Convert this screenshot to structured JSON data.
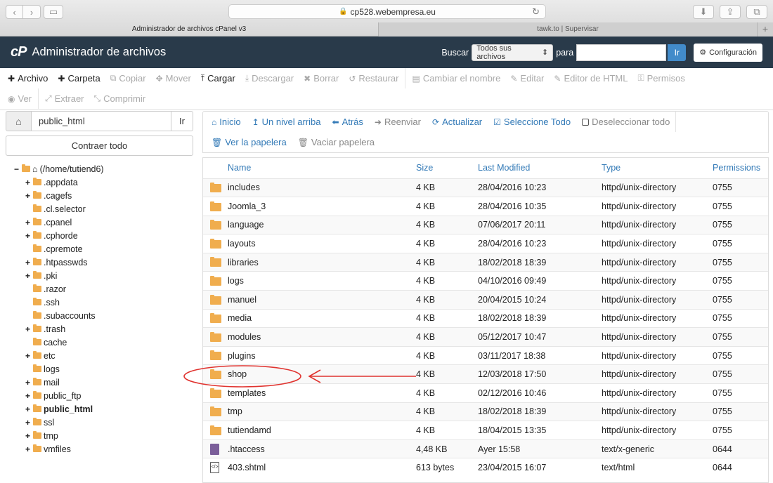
{
  "browser": {
    "url": "cp528.webempresa.eu",
    "tabs": [
      {
        "label": "Administrador de archivos cPanel v3",
        "active": true
      },
      {
        "label": "tawk.to | Supervisar",
        "active": false
      }
    ]
  },
  "header": {
    "logo": "cP",
    "title": "Administrador de archivos",
    "search_label": "Buscar",
    "search_scope": "Todos sus archivos",
    "for_label": "para",
    "search_query": "",
    "go_label": "Ir",
    "settings_label": "Configuración"
  },
  "toolbar": {
    "row1": [
      {
        "label": "Archivo",
        "icon": "plus-icon",
        "glyph": "✚",
        "enabled": true
      },
      {
        "label": "Carpeta",
        "icon": "plus-icon",
        "glyph": "✚",
        "enabled": true
      },
      {
        "label": "Copiar",
        "icon": "copy-icon",
        "glyph": "⧉",
        "enabled": false
      },
      {
        "label": "Mover",
        "icon": "move-icon",
        "glyph": "✥",
        "enabled": false
      },
      {
        "label": "Cargar",
        "icon": "upload-icon",
        "glyph": "⤒",
        "enabled": true
      },
      {
        "label": "Descargar",
        "icon": "download-icon",
        "glyph": "⤓",
        "enabled": false
      },
      {
        "label": "Borrar",
        "icon": "delete-icon",
        "glyph": "✖",
        "enabled": false
      },
      {
        "label": "Restaurar",
        "icon": "restore-icon",
        "glyph": "↺",
        "enabled": false
      },
      {
        "label": "Cambiar el nombre",
        "icon": "rename-icon",
        "glyph": "▤",
        "enabled": false
      },
      {
        "label": "Editar",
        "icon": "pencil-icon",
        "glyph": "✎",
        "enabled": false
      },
      {
        "label": "Editor de HTML",
        "icon": "html-editor-icon",
        "glyph": "✎",
        "enabled": false
      },
      {
        "label": "Permisos",
        "icon": "key-icon",
        "glyph": "⚿",
        "enabled": false
      }
    ],
    "row2": [
      {
        "label": "Ver",
        "icon": "eye-icon",
        "glyph": "◉",
        "enabled": false
      },
      {
        "label": "Extraer",
        "icon": "extract-icon",
        "glyph": "⤢",
        "enabled": false
      },
      {
        "label": "Comprimir",
        "icon": "compress-icon",
        "glyph": "⤡",
        "enabled": false
      }
    ]
  },
  "left": {
    "path_value": "public_html",
    "go_label": "Ir",
    "collapse_label": "Contraer todo",
    "root_label": "(/home/tutiend6)",
    "tree": [
      {
        "label": ".appdata",
        "expandable": true
      },
      {
        "label": ".cagefs",
        "expandable": true
      },
      {
        "label": ".cl.selector",
        "expandable": false
      },
      {
        "label": ".cpanel",
        "expandable": true
      },
      {
        "label": ".cphorde",
        "expandable": true
      },
      {
        "label": ".cpremote",
        "expandable": false
      },
      {
        "label": ".htpasswds",
        "expandable": true
      },
      {
        "label": ".pki",
        "expandable": true
      },
      {
        "label": ".razor",
        "expandable": false
      },
      {
        "label": ".ssh",
        "expandable": false
      },
      {
        "label": ".subaccounts",
        "expandable": false
      },
      {
        "label": ".trash",
        "expandable": true
      },
      {
        "label": "cache",
        "expandable": false
      },
      {
        "label": "etc",
        "expandable": true
      },
      {
        "label": "logs",
        "expandable": false
      },
      {
        "label": "mail",
        "expandable": true
      },
      {
        "label": "public_ftp",
        "expandable": true
      },
      {
        "label": "public_html",
        "expandable": true,
        "bold": true
      },
      {
        "label": "ssl",
        "expandable": true
      },
      {
        "label": "tmp",
        "expandable": true
      },
      {
        "label": "vmfiles",
        "expandable": true
      }
    ]
  },
  "nav": {
    "row1": [
      {
        "label": "Inicio",
        "icon": "home-icon",
        "glyph": "⌂",
        "enabled": true
      },
      {
        "label": "Un nivel arriba",
        "icon": "level-up-icon",
        "glyph": "↥",
        "enabled": true
      },
      {
        "label": "Atrás",
        "icon": "back-arrow-icon",
        "glyph": "⬅",
        "enabled": true
      },
      {
        "label": "Reenviar",
        "icon": "forward-arrow-icon",
        "glyph": "➜",
        "enabled": false
      },
      {
        "label": "Actualizar",
        "icon": "refresh-icon",
        "glyph": "⟳",
        "enabled": true
      },
      {
        "label": "Seleccione Todo",
        "icon": "check-square-icon",
        "glyph": "☑",
        "enabled": true
      },
      {
        "label": "Deseleccionar todo",
        "icon": "square-icon",
        "glyph": "",
        "enabled": false
      }
    ],
    "row2": [
      {
        "label": "Ver la papelera",
        "icon": "trash-icon",
        "glyph": "🗑",
        "enabled": true
      },
      {
        "label": "Vaciar papelera",
        "icon": "trash-icon",
        "glyph": "🗑",
        "enabled": false
      }
    ]
  },
  "table": {
    "columns": [
      "Name",
      "Size",
      "Last Modified",
      "Type",
      "Permissions"
    ],
    "rows": [
      {
        "name": "includes",
        "size": "4 KB",
        "modified": "28/04/2016 10:23",
        "type": "httpd/unix-directory",
        "perm": "0755",
        "kind": "folder"
      },
      {
        "name": "Joomla_3",
        "size": "4 KB",
        "modified": "28/04/2016 10:35",
        "type": "httpd/unix-directory",
        "perm": "0755",
        "kind": "folder"
      },
      {
        "name": "language",
        "size": "4 KB",
        "modified": "07/06/2017 20:11",
        "type": "httpd/unix-directory",
        "perm": "0755",
        "kind": "folder"
      },
      {
        "name": "layouts",
        "size": "4 KB",
        "modified": "28/04/2016 10:23",
        "type": "httpd/unix-directory",
        "perm": "0755",
        "kind": "folder"
      },
      {
        "name": "libraries",
        "size": "4 KB",
        "modified": "18/02/2018 18:39",
        "type": "httpd/unix-directory",
        "perm": "0755",
        "kind": "folder"
      },
      {
        "name": "logs",
        "size": "4 KB",
        "modified": "04/10/2016 09:49",
        "type": "httpd/unix-directory",
        "perm": "0755",
        "kind": "folder"
      },
      {
        "name": "manuel",
        "size": "4 KB",
        "modified": "20/04/2015 10:24",
        "type": "httpd/unix-directory",
        "perm": "0755",
        "kind": "folder"
      },
      {
        "name": "media",
        "size": "4 KB",
        "modified": "18/02/2018 18:39",
        "type": "httpd/unix-directory",
        "perm": "0755",
        "kind": "folder"
      },
      {
        "name": "modules",
        "size": "4 KB",
        "modified": "05/12/2017 10:47",
        "type": "httpd/unix-directory",
        "perm": "0755",
        "kind": "folder"
      },
      {
        "name": "plugins",
        "size": "4 KB",
        "modified": "03/11/2017 18:38",
        "type": "httpd/unix-directory",
        "perm": "0755",
        "kind": "folder"
      },
      {
        "name": "shop",
        "size": "4 KB",
        "modified": "12/03/2018 17:50",
        "type": "httpd/unix-directory",
        "perm": "0755",
        "kind": "folder"
      },
      {
        "name": "templates",
        "size": "4 KB",
        "modified": "02/12/2016 10:46",
        "type": "httpd/unix-directory",
        "perm": "0755",
        "kind": "folder"
      },
      {
        "name": "tmp",
        "size": "4 KB",
        "modified": "18/02/2018 18:39",
        "type": "httpd/unix-directory",
        "perm": "0755",
        "kind": "folder"
      },
      {
        "name": "tutiendamd",
        "size": "4 KB",
        "modified": "18/04/2015 13:35",
        "type": "httpd/unix-directory",
        "perm": "0755",
        "kind": "folder"
      },
      {
        "name": ".htaccess",
        "size": "4,48 KB",
        "modified": "Ayer 15:58",
        "type": "text/x-generic",
        "perm": "0644",
        "kind": "generic"
      },
      {
        "name": "403.shtml",
        "size": "613 bytes",
        "modified": "23/04/2015 16:07",
        "type": "text/html",
        "perm": "0644",
        "kind": "html"
      }
    ]
  },
  "colors": {
    "header_bg": "#293a4a",
    "link": "#337ab7",
    "folder": "#f0ad4e",
    "annotation": "#e0332f"
  }
}
